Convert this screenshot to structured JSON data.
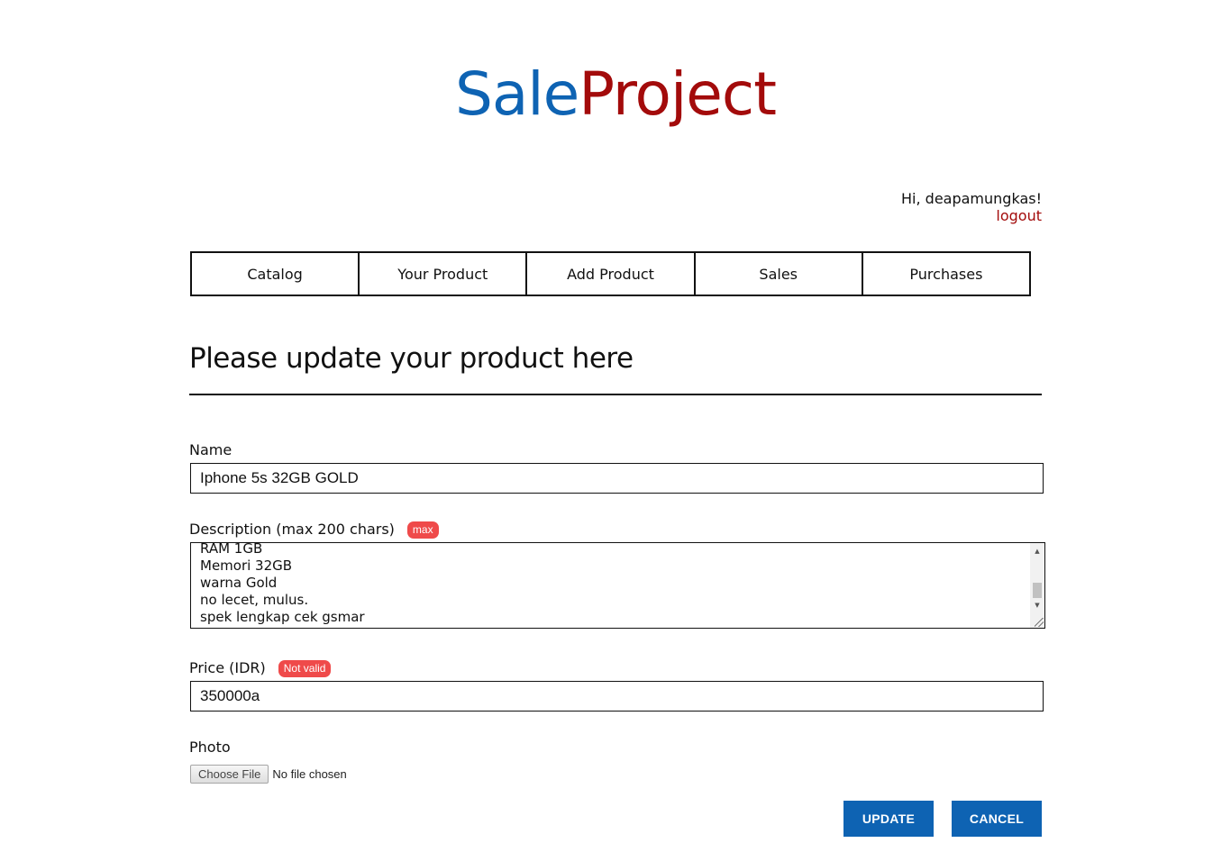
{
  "brand": {
    "part1": "Sale",
    "part2": "Project",
    "color_part1": "#0e63b3",
    "color_part2": "#a30b0b"
  },
  "user": {
    "greeting": "Hi, deapamungkas!",
    "logout_label": "logout"
  },
  "nav": {
    "items": [
      {
        "label": "Catalog"
      },
      {
        "label": "Your Product"
      },
      {
        "label": "Add Product"
      },
      {
        "label": "Sales"
      },
      {
        "label": "Purchases"
      }
    ]
  },
  "page": {
    "title": "Please update your product here"
  },
  "form": {
    "name": {
      "label": "Name",
      "value": "Iphone 5s 32GB GOLD"
    },
    "description": {
      "label": "Description (max 200 chars)",
      "badge": "max",
      "visible_lines": [
        "RAM 1GB",
        "Memori 32GB",
        "warna Gold",
        "no lecet, mulus.",
        "spek lengkap cek gsmar"
      ]
    },
    "price": {
      "label": "Price (IDR)",
      "badge": "Not valid",
      "value": "350000a"
    },
    "photo": {
      "label": "Photo",
      "button_label": "Choose File",
      "status": "No file chosen"
    }
  },
  "actions": {
    "update_label": "UPDATE",
    "cancel_label": "CANCEL",
    "button_color": "#0e63b3",
    "badge_color": "#ef4a4a"
  }
}
